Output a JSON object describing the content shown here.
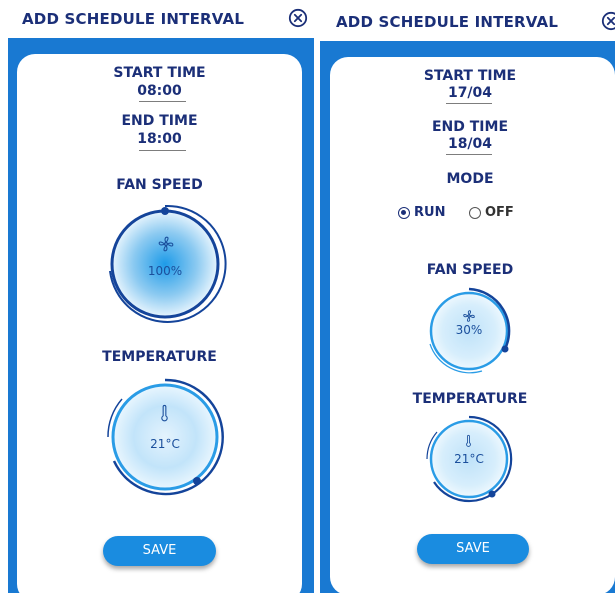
{
  "screens": [
    {
      "title": "ADD SCHEDULE INTERVAL",
      "start_label": "START TIME",
      "start_value": "08:00",
      "end_label": "END TIME",
      "end_value": "18:00",
      "fan_label": "FAN SPEED",
      "fan_value": "100%",
      "fan_level": 1.0,
      "temp_label": "TEMPERATURE",
      "temp_value": "21°C",
      "temp_level": 0.62,
      "save_label": "SAVE"
    },
    {
      "title": "ADD SCHEDULE INTERVAL",
      "start_label": "START TIME",
      "start_value": "17/04",
      "end_label": "END TIME",
      "end_value": "18/04",
      "mode_label": "MODE",
      "mode_options": [
        "RUN",
        "OFF"
      ],
      "mode_selected": "RUN",
      "fan_label": "FAN SPEED",
      "fan_value": "30%",
      "fan_level": 0.3,
      "temp_label": "TEMPERATURE",
      "temp_value": "21°C",
      "temp_level": 0.62,
      "save_label": "SAVE"
    }
  ],
  "icons": [
    "close-icon",
    "fan-icon",
    "thermometer-icon"
  ],
  "colors": {
    "title": "#1b2f78",
    "frame": "#1979d2",
    "dial_ring": "#1566c0",
    "dial_center": "#1e9be8",
    "button": "#1a8ce0"
  }
}
